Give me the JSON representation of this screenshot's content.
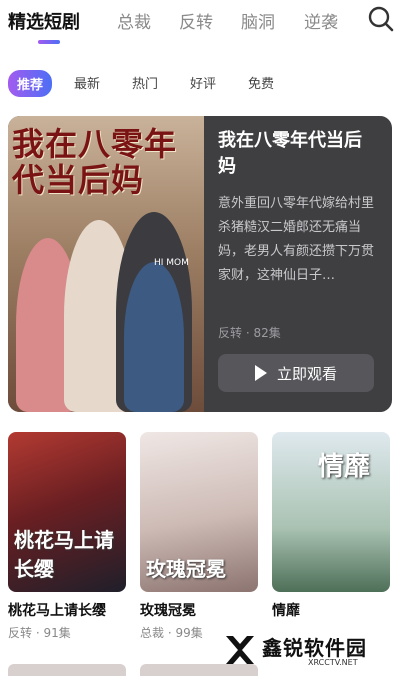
{
  "top_tabs": [
    "精选短剧",
    "总裁",
    "反转",
    "脑洞",
    "逆袭"
  ],
  "filters": [
    "推荐",
    "最新",
    "热门",
    "好评",
    "免费"
  ],
  "featured": {
    "poster_text": "我在八零年代当后妈",
    "poster_badge": "HI MOM",
    "title": "我在八零年代当后妈",
    "description": "意外重回八零年代嫁给村里杀猪糙汉二婚郎还无痛当妈，老男人有颜还攒下万贯家财，这神仙日子…",
    "meta": "反转 · 82集",
    "watch_label": "立即观看"
  },
  "dramas": [
    {
      "title": "桃花马上请长缨",
      "meta": "反转 · 91集",
      "poster_text": "桃花马上请长缨"
    },
    {
      "title": "玫瑰冠冕",
      "meta": "总裁 · 99集",
      "poster_text": "玫瑰冠冕"
    },
    {
      "title": "情靡",
      "meta": "",
      "poster_text": "情靡"
    }
  ],
  "watermark": {
    "name": "鑫锐软件园",
    "url": "XRCCTV.NET"
  },
  "colors": {
    "accent_start": "#a35bf0",
    "accent_end": "#4c6ef5",
    "card_bg": "#3f3f42"
  },
  "icons": {
    "search": "search-icon",
    "play": "play-icon"
  }
}
